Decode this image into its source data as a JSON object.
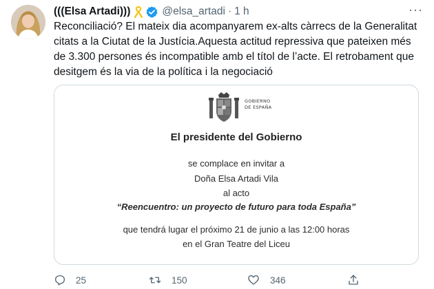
{
  "tweet": {
    "author_name": "(((Elsa Artadi)))",
    "handle": "@elsa_artadi",
    "separator": "·",
    "time": "1 h",
    "more_label": "···",
    "text": "Reconciliació? El mateix dia acompanyarem ex-alts càrrecs de la Generalitat citats a la Ciutat de la Justícia.Aquesta actitud repressiva que pateixen més de 3.300 persones és incompatible amb el títol de l’acte. El retrobament que desitgem és la via de la política i la negociació"
  },
  "invitation": {
    "gov_line1": "GOBIERNO",
    "gov_line2": "DE ESPAÑA",
    "title": "El presidente del Gobierno",
    "line1": "se complace en invitar a",
    "line2": "Doña Elsa Artadi Vila",
    "line3": "al acto",
    "event": "“Reencuentro: un proyecto de futuro para toda España”",
    "line4": "que tendrá lugar el próximo 21 de junio a las 12:00 horas",
    "line5": "en el Gran Teatre del Liceu"
  },
  "actions": {
    "replies": "25",
    "retweets": "150",
    "likes": "346"
  },
  "icons": {
    "ribbon": "yellow-ribbon-icon",
    "verified": "verified-badge-icon",
    "reply": "reply-icon",
    "retweet": "retweet-icon",
    "like": "heart-icon",
    "share": "share-icon"
  },
  "colors": {
    "verified": "#1d9bf0",
    "ribbon": "#f5c518",
    "secondary_text": "#536471",
    "card_border": "#cfd9de"
  }
}
